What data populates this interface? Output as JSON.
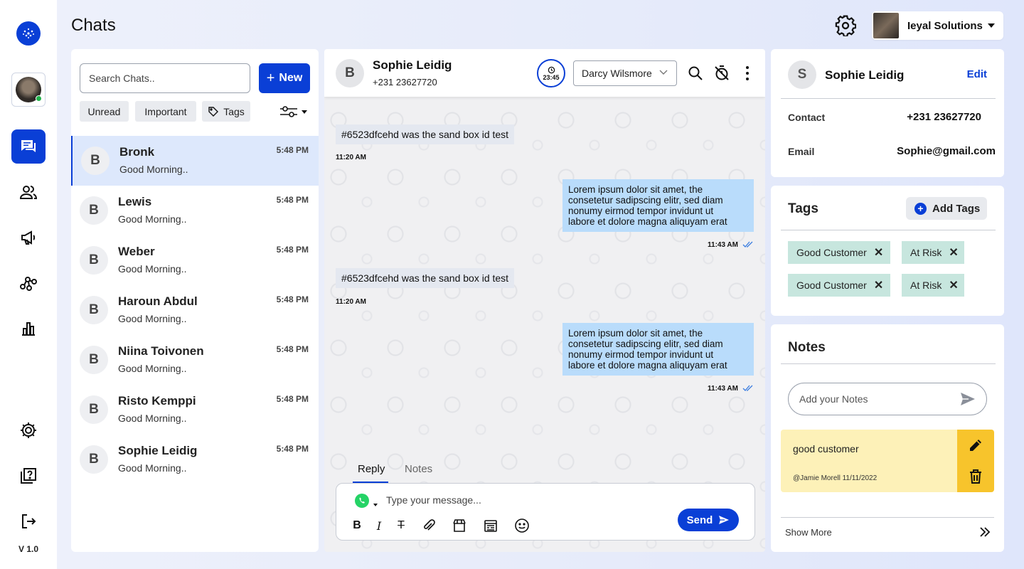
{
  "page": {
    "title": "Chats"
  },
  "rail": {
    "version": "V 1.0"
  },
  "account": {
    "name": "Ieyal Solutions"
  },
  "chat_list": {
    "search_placeholder": "Search Chats..",
    "new_label": "New",
    "filters": [
      "Unread",
      "Important",
      "Tags"
    ],
    "items": [
      {
        "initial": "B",
        "name": "Bronk",
        "preview": "Good Morning..",
        "time": "5:48 PM"
      },
      {
        "initial": "B",
        "name": "Lewis",
        "preview": "Good Morning..",
        "time": "5:48 PM"
      },
      {
        "initial": "B",
        "name": "Weber",
        "preview": "Good Morning..",
        "time": "5:48 PM"
      },
      {
        "initial": "B",
        "name": "Haroun Abdul",
        "preview": "Good Morning..",
        "time": "5:48 PM"
      },
      {
        "initial": "B",
        "name": "Niina Toivonen",
        "preview": "Good Morning..",
        "time": "5:48 PM"
      },
      {
        "initial": "B",
        "name": "Risto Kemppi",
        "preview": "Good Morning..",
        "time": "5:48 PM"
      },
      {
        "initial": "B",
        "name": "Sophie Leidig",
        "preview": "Good Morning..",
        "time": "5:48 PM"
      }
    ]
  },
  "conversation": {
    "contact_initial": "B",
    "contact_name": "Sophie Leidig",
    "contact_phone": "+231 23627720",
    "timer": "23:45",
    "agent": "Darcy Wilsmore",
    "messages": [
      {
        "direction": "in",
        "text": "#6523dfcehd was the sand box id test",
        "time": "11:20 AM"
      },
      {
        "direction": "out",
        "lines": [
          "Lorem ipsum dolor sit amet, the",
          "consetetur sadipscing elitr, sed diam",
          "nonumy eirmod tempor invidunt ut",
          "labore et dolore magna aliquyam erat"
        ],
        "time": "11:43 AM"
      },
      {
        "direction": "in",
        "text": "#6523dfcehd was the sand box id test",
        "time": "11:20 AM"
      },
      {
        "direction": "out",
        "lines": [
          "Lorem ipsum dolor sit amet, the",
          "consetetur sadipscing elitr, sed diam",
          "nonumy eirmod tempor invidunt ut",
          "labore et dolore magna aliquyam erat"
        ],
        "time": "11:43 AM"
      }
    ],
    "tabs": {
      "reply": "Reply",
      "notes": "Notes"
    },
    "composer_placeholder": "Type your message...",
    "send_label": "Send"
  },
  "contact": {
    "initial": "S",
    "name": "Sophie Leidig",
    "edit_label": "Edit",
    "contact_label": "Contact",
    "contact_value": "+231 23627720",
    "email_label": "Email",
    "email_value": "Sophie@gmail.com"
  },
  "tags_card": {
    "title": "Tags",
    "add_label": "Add Tags",
    "tags": [
      "Good Customer",
      "At Risk",
      "Good Customer",
      "At Risk"
    ]
  },
  "notes_card": {
    "title": "Notes",
    "input_placeholder": "Add your Notes",
    "note_text": "good customer",
    "note_meta": "@Jamie Morell 11/11/2022",
    "show_more": "Show More"
  },
  "colors": {
    "accent": "#0a3fd6",
    "outgoing_bubble": "#b9dcfb",
    "tag_bg": "#c7e6de",
    "note_bg": "#fdf1b8",
    "note_actions": "#f7c42c"
  }
}
